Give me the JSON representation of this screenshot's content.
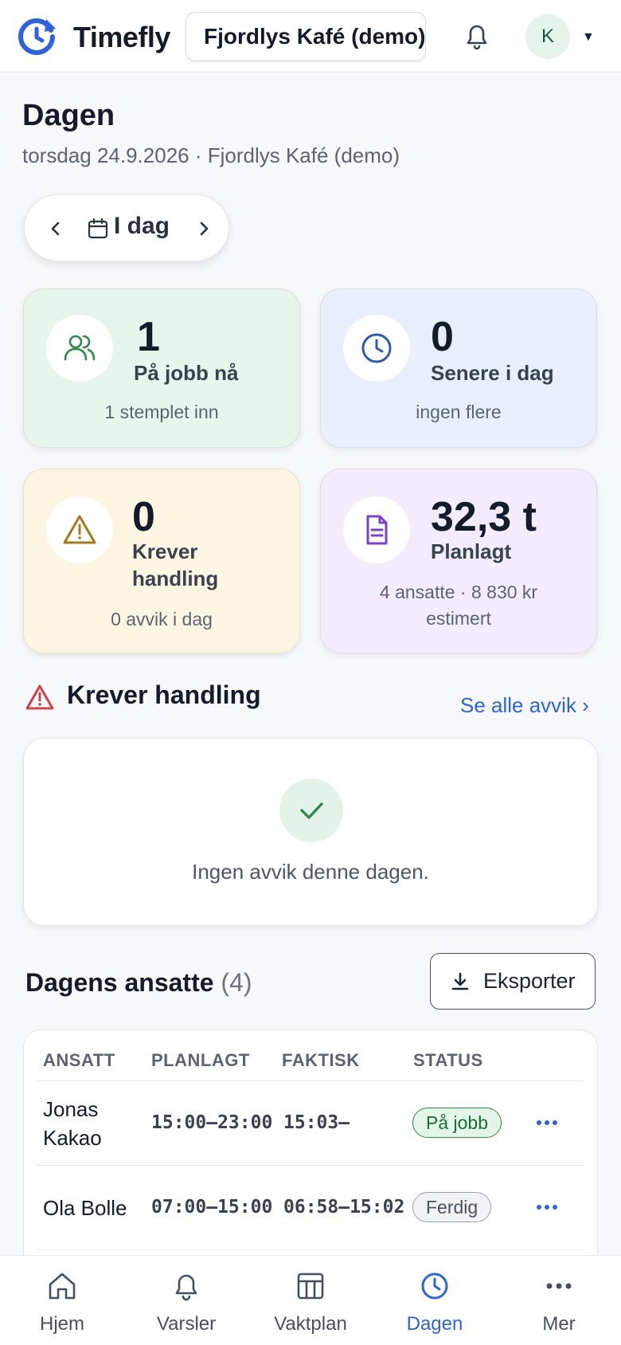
{
  "app": {
    "brand": "Timefly",
    "org": "Fjordlys Kafé (demo)",
    "avatar_initial": "K",
    "accent": "#2d63e0"
  },
  "page": {
    "title": "Dagen",
    "subtitle": "torsdag 24.9.2026 · Fjordlys Kafé (demo)",
    "day_label": "I dag"
  },
  "stats": [
    {
      "value": "1",
      "label": "På jobb nå",
      "foot": "1 stemplet inn"
    },
    {
      "value": "0",
      "label": "Senere i dag",
      "foot": "ingen flere"
    },
    {
      "value": "0",
      "label": "Krever handling",
      "foot": "0 avvik i dag"
    },
    {
      "value": "32,3 t",
      "label": "Planlagt",
      "foot": "4 ansatte · 8 830 kr estimert"
    }
  ],
  "action": {
    "title": "Krever handling",
    "see_all": "Se alle avvik ›",
    "empty": "Ingen avvik denne dagen."
  },
  "employees": {
    "title": "Dagens ansatte",
    "count": "(4)",
    "export": "Eksporter",
    "headers": [
      "ANSATT",
      "PLANLAGT",
      "FAKTISK",
      "STATUS"
    ],
    "rows": [
      {
        "name": "Jonas Kakao",
        "planned": "15:00–23:00",
        "actual": "15:03–",
        "status": "På jobb"
      },
      {
        "name": "Ola Bolle",
        "planned": "07:00–15:00",
        "actual": "06:58–15:02",
        "status": "Ferdig"
      }
    ]
  },
  "nav": [
    {
      "label": "Hjem",
      "icon": "home-icon"
    },
    {
      "label": "Varsler",
      "icon": "bell-icon"
    },
    {
      "label": "Vaktplan",
      "icon": "grid-calendar-icon"
    },
    {
      "label": "Dagen",
      "icon": "clock-icon",
      "active": true
    },
    {
      "label": "Mer",
      "icon": "more-dots-icon"
    }
  ]
}
